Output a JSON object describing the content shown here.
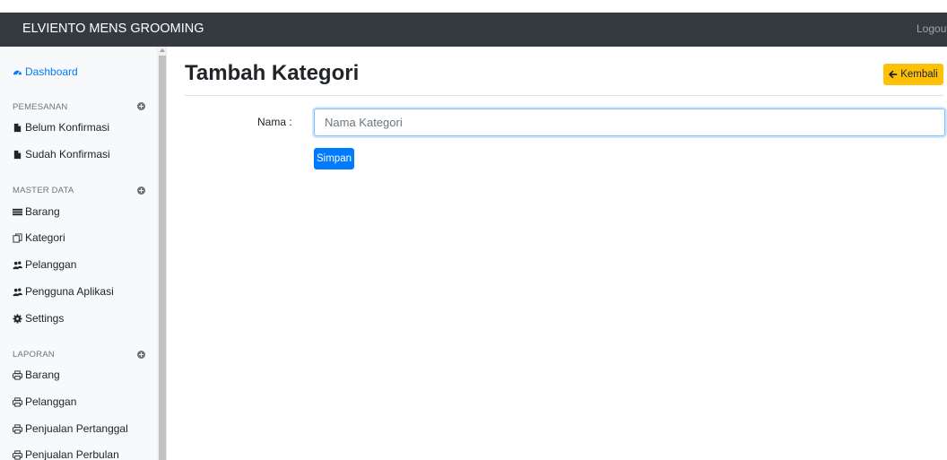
{
  "topbar": {
    "brand": "ELVIENTO MENS GROOMING",
    "logout_label": "Logout"
  },
  "sidebar": {
    "dashboard": {
      "label": "Dashboard",
      "icon": "dashboard-icon"
    },
    "sections": [
      {
        "title": "PEMESANAN",
        "items": [
          {
            "label": "Belum Konfirmasi",
            "icon": "file-icon"
          },
          {
            "label": "Sudah Konfirmasi",
            "icon": "file-icon"
          }
        ]
      },
      {
        "title": "MASTER DATA",
        "items": [
          {
            "label": "Barang",
            "icon": "list-icon"
          },
          {
            "label": "Kategori",
            "icon": "copy-icon"
          },
          {
            "label": "Pelanggan",
            "icon": "users-icon"
          },
          {
            "label": "Pengguna Aplikasi",
            "icon": "users-icon"
          },
          {
            "label": "Settings",
            "icon": "gear-icon"
          }
        ]
      },
      {
        "title": "LAPORAN",
        "items": [
          {
            "label": "Barang",
            "icon": "print-icon"
          },
          {
            "label": "Pelanggan",
            "icon": "print-icon"
          },
          {
            "label": "Penjualan Pertanggal",
            "icon": "print-icon"
          },
          {
            "label": "Penjualan Perbulan",
            "icon": "print-icon"
          }
        ]
      }
    ]
  },
  "main": {
    "title": "Tambah Kategori",
    "back_label": "Kembali",
    "form": {
      "name_label": "Nama :",
      "name_placeholder": "Nama Kategori",
      "name_value": "",
      "submit_label": "Simpan"
    }
  },
  "colors": {
    "topbar_bg": "#343a40",
    "primary": "#007bff",
    "warning": "#ffc107",
    "sidebar_bg": "#f8f9fa"
  }
}
